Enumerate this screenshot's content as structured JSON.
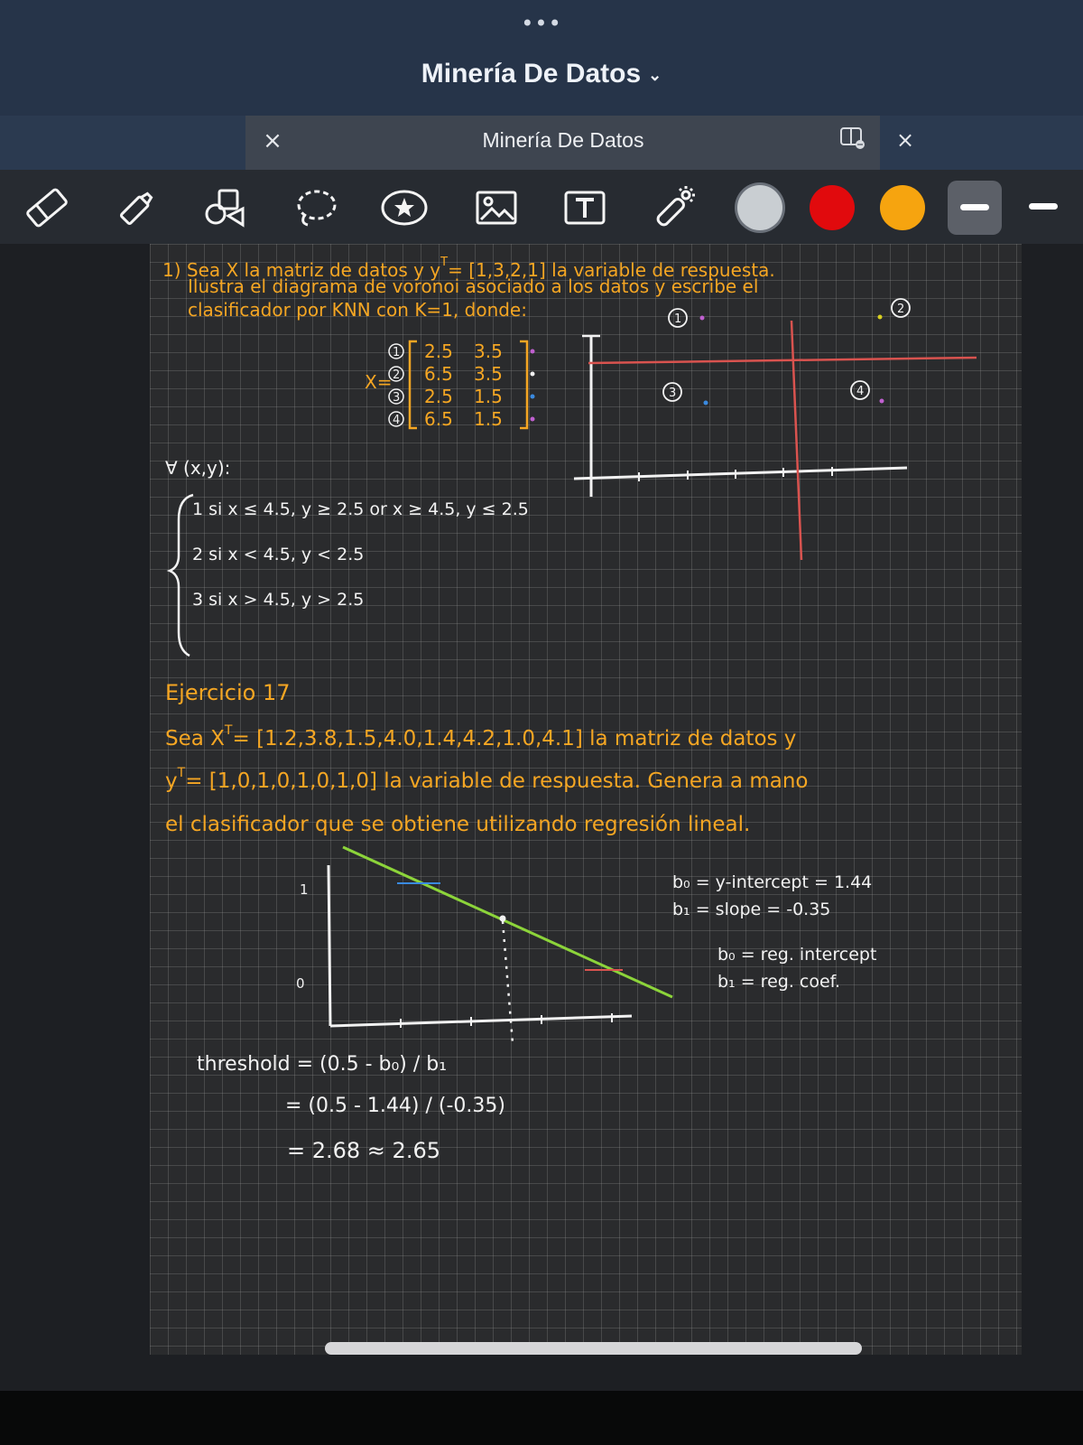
{
  "app": {
    "dots": "•••",
    "title": "Minería De Datos"
  },
  "document_tab": {
    "title": "Minería De Datos"
  },
  "toolbar": {
    "tools": [
      "eraser-icon",
      "highlighter-icon",
      "shapes-icon",
      "lasso-icon",
      "sticker-icon",
      "image-icon",
      "text-box-icon",
      "laser-pointer-icon"
    ],
    "colors": {
      "gray": "#c9ced2",
      "red": "#e10a0d",
      "orange": "#f6a40f"
    }
  },
  "note": {
    "colors": {
      "orange": "#f5a623",
      "white": "#f2f2f2",
      "red": "#d9534f",
      "green": "#8cd43a"
    },
    "p1": {
      "line1": "1) Sea X la matriz de datos y y",
      "line1_sup": "T",
      "line1_b": "= [1,3,2,1] la variable de respuesta.",
      "line2": "Ilustra el diagrama de voronoi asociado a los datos y escribe el",
      "line3": "clasificador por KNN con K=1, donde:",
      "matrix_label": "X=",
      "rows": [
        {
          "id": "1",
          "a": "2.5",
          "b": "3.5"
        },
        {
          "id": "2",
          "a": "6.5",
          "b": "3.5"
        },
        {
          "id": "3",
          "a": "2.5",
          "b": "1.5"
        },
        {
          "id": "4",
          "a": "6.5",
          "b": "1.5"
        }
      ],
      "forall": "∀ (x,y):",
      "cases": [
        "1  si  x ≤ 4.5, y ≥ 2.5 or x ≥ 4.5, y ≤ 2.5",
        "2  si  x < 4.5, y < 2.5",
        "3  si  x > 4.5, y > 2.5"
      ],
      "plot_labels": [
        "1",
        "2",
        "3",
        "4"
      ]
    },
    "p2": {
      "heading": "Ejercicio 17",
      "line1": "Sea X",
      "line1_sup": "T",
      "line1_b": "= [1.2,3.8,1.5,4.0,1.4,4.2,1.0,4.1] la matriz de datos y",
      "line2": "y",
      "line2_sup": "T",
      "line2_b": "= [1,0,1,0,1,0,1,0] la variable de respuesta. Genera a mano",
      "line3": "el clasificador que se obtiene utilizando regresión lineal.",
      "axis_one": "1",
      "axis_zero": "0",
      "b0_line": "b₀ = y-intercept = 1.44",
      "b1_line": "b₁ = slope = -0.35",
      "b0_def": "b₀ = reg. intercept",
      "b1_def": "b₁ = reg. coef.",
      "threshold1": "threshold = (0.5 - b₀) / b₁",
      "threshold2": "= (0.5 - 1.44) / (-0.35)",
      "threshold3": "= 2.68 ≈ 2.65"
    }
  }
}
